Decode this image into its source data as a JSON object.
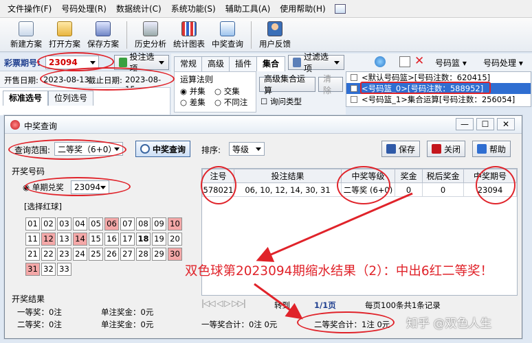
{
  "menu": [
    "文件操作(F)",
    "号码处理(R)",
    "数据统计(C)",
    "系统功能(S)",
    "辅助工具(A)",
    "使用帮助(H)"
  ],
  "toolbar": [
    "新建方案",
    "打开方案",
    "保存方案",
    "历史分析",
    "统计图表",
    "中奖查询",
    "用户反馈"
  ],
  "issue": {
    "label": "彩票期号:",
    "value": "23094",
    "bet_option": "投注选项"
  },
  "dates": {
    "open_label": "开售日期:",
    "open": "2023-08-13",
    "close_label": "截止日期:",
    "close": "2023-08-15"
  },
  "left_tabs": [
    "标准选号",
    "位列选号"
  ],
  "center_tabs": [
    "常规",
    "高级",
    "插件",
    "集合"
  ],
  "filter_option": "过滤选项",
  "ops": {
    "title": "运算法则",
    "union": "并集",
    "intersect": "交集",
    "diff": "差集",
    "notin": "不同注",
    "adv_button": "高级集合运算",
    "clear_button": "清除",
    "ask_type": "询问类型"
  },
  "right_toolbar": {
    "basket": "号码篮",
    "process": "号码处理"
  },
  "right_list": [
    "<默认号码篮>[号码注数：620415]",
    "<号码篮_0>[号码注数：588952]",
    "<号码篮_1>集合运算[号码注数：256054]"
  ],
  "dialog": {
    "title": "中奖查询",
    "range_label": "查询范围:",
    "range_value": "二等奖（6+0）",
    "query_button": "中奖查询",
    "sort_label": "排序:",
    "sort_value": "等级",
    "save_button": "保存",
    "close_button": "关闭",
    "help_button": "帮助",
    "draw_group": "开奖号码",
    "single_label": "单期兑奖",
    "single_value": "23094",
    "pick_red": "[选择红球]",
    "balls": [
      "01",
      "02",
      "03",
      "04",
      "05",
      "06",
      "07",
      "08",
      "09",
      "10",
      "11",
      "12",
      "13",
      "14",
      "15",
      "16",
      "17",
      "18",
      "19",
      "20",
      "21",
      "22",
      "23",
      "24",
      "25",
      "26",
      "27",
      "28",
      "29",
      "30",
      "31",
      "32",
      "33"
    ],
    "table_headers": [
      "注号",
      "投注结果",
      "中奖等级",
      "奖金",
      "税后奖金",
      "中奖期号"
    ],
    "table_row": [
      "578021",
      "06, 10, 12, 14, 30, 31",
      "二等奖 (6+0)",
      "0",
      "0",
      "23094"
    ],
    "result_group": "开奖结果",
    "first_prize": "一等奖：0注",
    "first_money": "单注奖金：0元",
    "second_prize": "二等奖：0注",
    "second_money": "单注奖金：0元",
    "goto": "转到",
    "page": "1/1页",
    "per_page": "每页100条共1条记录",
    "first_total": "一等奖合计：0注  0元",
    "second_total": "二等奖合计：1注  0元"
  },
  "annotation": "双色球第2023094期缩水结果（2）：中出6红二等奖！",
  "watermark": "知乎 @双色人生",
  "colors": {
    "annotation_red": "#e0232a",
    "ball_red": "#f4a8a8",
    "select_blue": "#2f6ed1"
  }
}
